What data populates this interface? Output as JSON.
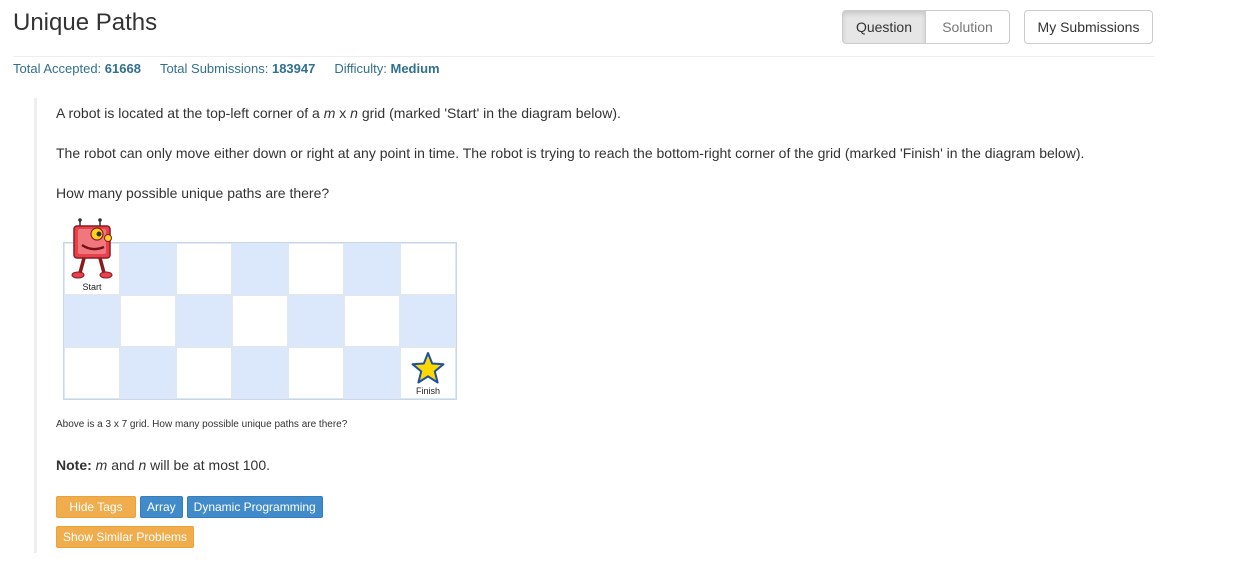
{
  "header": {
    "title": "Unique Paths",
    "tabs": [
      {
        "label": "Question"
      },
      {
        "label": "Solution"
      }
    ],
    "submissions_label": "My Submissions"
  },
  "stats": {
    "accepted_label": "Total Accepted:",
    "accepted_value": "61668",
    "submissions_label": "Total Submissions:",
    "submissions_value": "183947",
    "difficulty_label": "Difficulty:",
    "difficulty_value": "Medium"
  },
  "problem": {
    "p1_before": "A robot is located at the top-left corner of a ",
    "p1_m": "m",
    "p1_x": " x ",
    "p1_n": "n",
    "p1_after": " grid (marked 'Start' in the diagram below).",
    "p2": "The robot can only move either down or right at any point in time. The robot is trying to reach the bottom-right corner of the grid (marked 'Finish' in the diagram below).",
    "p3": "How many possible unique paths are there?",
    "start_label": "Start",
    "finish_label": "Finish",
    "caption": "Above is a 3 x 7 grid. How many possible unique paths are there?",
    "note_label": "Note:",
    "note_m": "m",
    "note_and": " and ",
    "note_n": "n",
    "note_after": " will be at most 100."
  },
  "tags": {
    "hide_label": "Hide Tags",
    "items": [
      "Array",
      "Dynamic Programming"
    ],
    "similar_label": "Show Similar Problems"
  },
  "colors": {
    "accent_warning": "#f0ad4e",
    "accent_primary": "#428bca",
    "grid_shade": "#dbe7fb",
    "stat_text": "#31708f"
  }
}
